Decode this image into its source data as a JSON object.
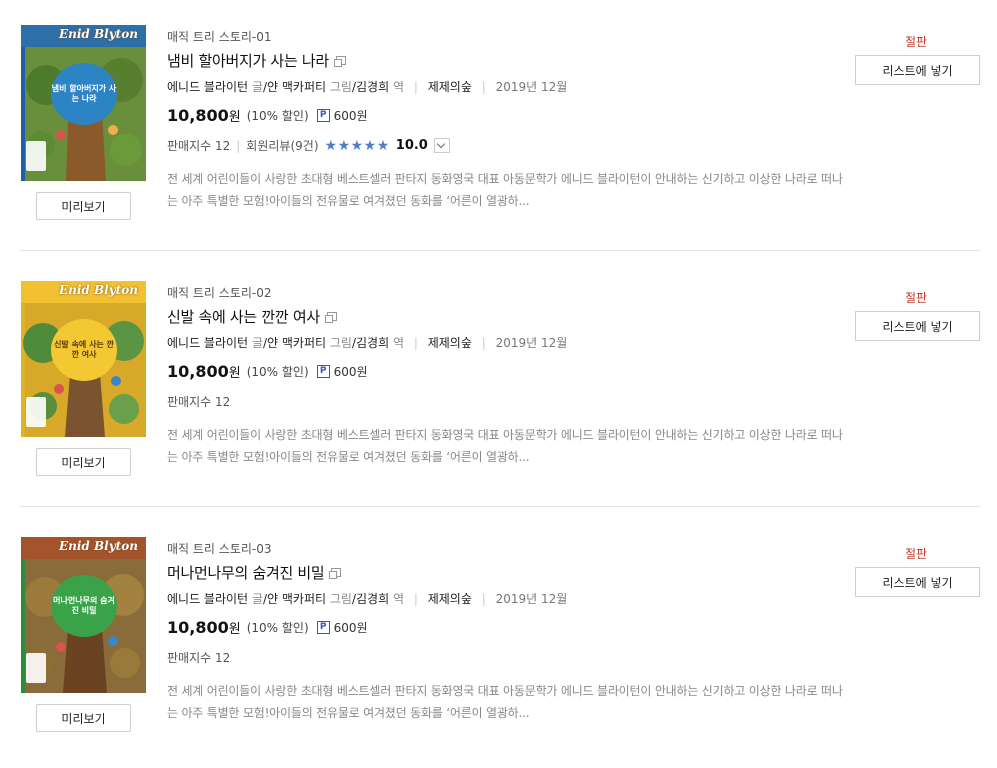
{
  "books": [
    {
      "series": "매직 트리 스토리-01",
      "title": "냄비 할아버지가 사는 나라",
      "author": "에니드 블라이턴",
      "author_role": "글",
      "illustrator": "/얀 맥카퍼티",
      "illustrator_role": "그림",
      "translator": "/김경희",
      "translator_role": "역",
      "publisher": "제제의숲",
      "date": "2019년 12월",
      "price": "10,800",
      "currency": "원",
      "discount": "(10% 할인)",
      "point_badge": "P",
      "points": "600원",
      "sales": "판매지수 12",
      "review_label": "회원리뷰",
      "review_count": "(9건)",
      "rating_stars": 5,
      "rating": "10.0",
      "description": "전 세계 어린이들이 사랑한 초대형 베스트셀러 판타지 동화영국 대표 아동문학가 에니드 블라이턴이 안내하는 신기하고 이상한 나라로 떠나는 아주 특별한 모험!아이들의 전유물로 여겨졌던 동화를 ‘어른이 열광하...",
      "status": "절판",
      "add_to_list_label": "리스트에 넣기",
      "preview_label": "미리보기",
      "cover": {
        "brand": "Enid Blyton",
        "title": "냄비 할아버지가 사는 나라",
        "bg": "#6a8f3c",
        "badge_bg": "#2d84c5",
        "edge": "#1e5fa8"
      }
    },
    {
      "series": "매직 트리 스토리-02",
      "title": "신발 속에 사는 깐깐 여사",
      "author": "에니드 블라이턴",
      "author_role": "글",
      "illustrator": "/얀 맥카퍼티",
      "illustrator_role": "그림",
      "translator": "/김경희",
      "translator_role": "역",
      "publisher": "제제의숲",
      "date": "2019년 12월",
      "price": "10,800",
      "currency": "원",
      "discount": "(10% 할인)",
      "point_badge": "P",
      "points": "600원",
      "sales": "판매지수 12",
      "description": "전 세계 어린이들이 사랑한 초대형 베스트셀러 판타지 동화영국 대표 아동문학가 에니드 블라이턴이 안내하는 신기하고 이상한 나라로 떠나는 아주 특별한 모험!아이들의 전유물로 여겨졌던 동화를 ‘어른이 열광하...",
      "status": "절판",
      "add_to_list_label": "리스트에 넣기",
      "preview_label": "미리보기",
      "cover": {
        "brand": "Enid Blyton",
        "title": "신발 속에 사는 깐깐 여사",
        "bg": "#d8a928",
        "badge_bg": "#f3c832",
        "edge": "#e0b22a"
      }
    },
    {
      "series": "매직 트리 스토리-03",
      "title": "머나먼나무의 숨겨진 비밀",
      "author": "에니드 블라이턴",
      "author_role": "글",
      "illustrator": "/얀 맥카퍼티",
      "illustrator_role": "그림",
      "translator": "/김경희",
      "translator_role": "역",
      "publisher": "제제의숲",
      "date": "2019년 12월",
      "price": "10,800",
      "currency": "원",
      "discount": "(10% 할인)",
      "point_badge": "P",
      "points": "600원",
      "sales": "판매지수 12",
      "description": "전 세계 어린이들이 사랑한 초대형 베스트셀러 판타지 동화영국 대표 아동문학가 에니드 블라이턴이 안내하는 신기하고 이상한 나라로 떠나는 아주 특별한 모험!아이들의 전유물로 여겨졌던 동화를 ‘어른이 열광하...",
      "status": "절판",
      "add_to_list_label": "리스트에 넣기",
      "preview_label": "미리보기",
      "cover": {
        "brand": "Enid Blyton",
        "title": "머나먼나무의 숨겨진 비밀",
        "bg": "#8a6b3a",
        "badge_bg": "#3aa34a",
        "edge": "#2e8b3e"
      }
    }
  ]
}
